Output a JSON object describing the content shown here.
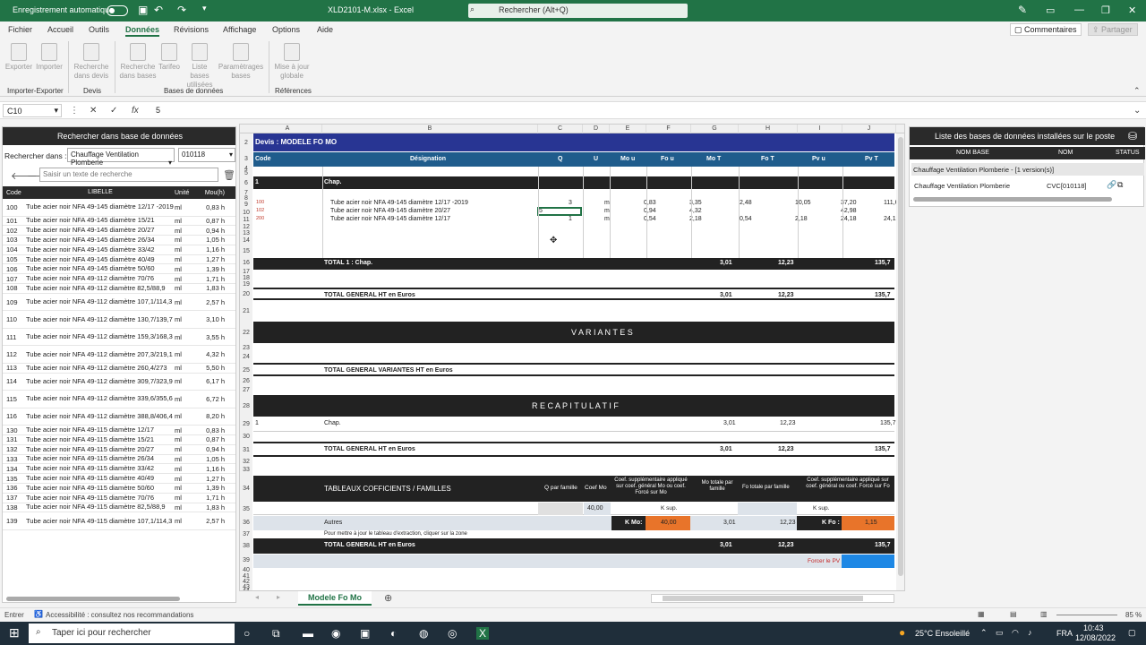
{
  "titlebar": {
    "autosave": "Enregistrement automatique",
    "filename": "XLD2101-M.xlsx  -  Excel",
    "search_placeholder": "Rechercher (Alt+Q)"
  },
  "menubar": {
    "items": [
      "Fichier",
      "Accueil",
      "Outils",
      "Données",
      "Révisions",
      "Affichage",
      "Options",
      "Aide"
    ],
    "active": "Données",
    "comments": "Commentaires",
    "share": "Partager"
  },
  "ribbon": {
    "buttons": [
      "Exporter",
      "Importer",
      "Recherche dans devis",
      "Recherche dans bases",
      "Tarifeo",
      "Liste bases utilisées",
      "Paramètrages bases",
      "Mise à jour globale"
    ],
    "groups": [
      "Importer-Exporter",
      "Devis",
      "Bases de données",
      "Références"
    ]
  },
  "formula": {
    "cell": "C10",
    "value": "5"
  },
  "leftpane": {
    "title": "Rechercher dans base de données",
    "search_in_label": "Rechercher dans :",
    "base_value": "Chauffage Ventilation Plomberie",
    "code_value": "010118",
    "search_placeholder": "Saisir un texte de recherche",
    "headers": [
      "Code",
      "LIBELLE",
      "Unité",
      "Mou(h)"
    ],
    "rows": [
      [
        "100",
        "Tube acier noir NFA 49-145 diamètre 12/17 -2019",
        "ml",
        "0,83 h"
      ],
      [
        "101",
        "Tube acier noir NFA 49-145 diamètre 15/21",
        "ml",
        "0,87 h"
      ],
      [
        "102",
        "Tube acier noir NFA 49-145 diamètre 20/27",
        "ml",
        "0,94 h"
      ],
      [
        "103",
        "Tube acier noir NFA 49-145 diamètre 26/34",
        "ml",
        "1,05 h"
      ],
      [
        "104",
        "Tube acier noir NFA 49-145 diamètre 33/42",
        "ml",
        "1,16 h"
      ],
      [
        "105",
        "Tube acier noir NFA 49-145 diamètre 40/49",
        "ml",
        "1,27 h"
      ],
      [
        "106",
        "Tube acier noir NFA 49-145 diamètre 50/60",
        "ml",
        "1,39 h"
      ],
      [
        "107",
        "Tube acier noir NFA 49-112 diamètre 70/76",
        "ml",
        "1,71 h"
      ],
      [
        "108",
        "Tube acier noir NFA 49-112 diamètre 82,5/88,9",
        "ml",
        "1,83 h"
      ],
      [
        "109",
        "Tube acier noir NFA 49-112 diamètre 107,1/114,3",
        "ml",
        "2,57 h"
      ],
      [
        "110",
        "Tube acier noir NFA 49-112 diamètre 130,7/139,7",
        "ml",
        "3,10 h"
      ],
      [
        "111",
        "Tube acier noir NFA 49-112 diamètre 159,3/168,3",
        "ml",
        "3,55 h"
      ],
      [
        "112",
        "Tube acier noir NFA 49-112 diamètre 207,3/219,1",
        "ml",
        "4,32 h"
      ],
      [
        "113",
        "Tube acier noir NFA 49-112 diamètre 260,4/273",
        "ml",
        "5,50 h"
      ],
      [
        "114",
        "Tube acier noir NFA 49-112 diamètre 309,7/323,9",
        "ml",
        "6,17 h"
      ],
      [
        "115",
        "Tube acier noir NFA 49-112 diamètre 339,6/355,6",
        "ml",
        "6,72 h"
      ],
      [
        "116",
        "Tube acier noir NFA 49-112 diamètre 388,8/406,4",
        "ml",
        "8,20 h"
      ],
      [
        "130",
        "Tube acier noir NFA 49-115 diamètre 12/17",
        "ml",
        "0,83 h"
      ],
      [
        "131",
        "Tube acier noir NFA 49-115 diamètre 15/21",
        "ml",
        "0,87 h"
      ],
      [
        "132",
        "Tube acier noir NFA 49-115 diamètre 20/27",
        "ml",
        "0,94 h"
      ],
      [
        "133",
        "Tube acier noir NFA 49-115 diamètre 26/34",
        "ml",
        "1,05 h"
      ],
      [
        "134",
        "Tube acier noir NFA 49-115 diamètre 33/42",
        "ml",
        "1,16 h"
      ],
      [
        "135",
        "Tube acier noir NFA 49-115 diamètre 40/49",
        "ml",
        "1,27 h"
      ],
      [
        "136",
        "Tube acier noir NFA 49-115 diamètre 50/60",
        "ml",
        "1,39 h"
      ],
      [
        "137",
        "Tube acier noir NFA 49-115 diamètre 70/76",
        "ml",
        "1,71 h"
      ],
      [
        "138",
        "Tube acier noir NFA 49-115 diamètre 82,5/88,9",
        "ml",
        "1,83 h"
      ],
      [
        "139",
        "Tube acier noir NFA 49-115 diamètre 107,1/114,3",
        "ml",
        "2,57 h"
      ]
    ]
  },
  "sheet": {
    "columns": [
      "A",
      "B",
      "C",
      "D",
      "E",
      "F",
      "G",
      "H",
      "I",
      "J"
    ],
    "devis_title": "Devis : MODELE FO MO",
    "headers": [
      "Code",
      "Désignation",
      "Q",
      "U",
      "Mo u",
      "Fo u",
      "Mo T",
      "Fo T",
      "Pv u",
      "Pv T"
    ],
    "chap_code": "1",
    "chap_label": "Chap.",
    "lines": [
      {
        "code": "100",
        "des": "Tube acier noir NFA 49-145 diamètre 12/17 -2019",
        "q": "3",
        "u": "ml",
        "mou": "0,83",
        "fou": "3,35",
        "mot": "2,48",
        "fot": "10,05",
        "pvu": "37,20",
        "pvt": "111,6"
      },
      {
        "code": "102",
        "des": "Tube acier noir NFA 49-145 diamètre 20/27",
        "q": "5",
        "u": "ml",
        "mou": "0,94",
        "fou": "4,32",
        "mot": "",
        "fot": "",
        "pvu": "42,98",
        "pvt": ""
      },
      {
        "code": "200",
        "des": "Tube acier noir NFA 49-145 diamètre 12/17",
        "q": "1",
        "u": "ml",
        "mou": "0,54",
        "fou": "2,18",
        "mot": "0,54",
        "fot": "2,18",
        "pvu": "24,18",
        "pvt": "24,1"
      }
    ],
    "total_chap": {
      "label": "TOTAL 1 : Chap.",
      "mot": "3,01",
      "fot": "12,23",
      "pvt": "135,7"
    },
    "total_general": {
      "label": "TOTAL GENERAL HT en Euros",
      "mot": "3,01",
      "fot": "12,23",
      "pvt": "135,7"
    },
    "variantes": "V A R I A N T E S",
    "total_variantes": "TOTAL GENERAL VARIANTES HT en Euros",
    "recap": "R E C A P I T U L A T I F",
    "recap_line": {
      "code": "1",
      "label": "Chap.",
      "mot": "3,01",
      "fot": "12,23",
      "pvt": "135,7"
    },
    "tableaux": {
      "title": "TABLEAUX COFFICIENTS / FAMILLES",
      "q_famille": "Q par famille",
      "coef_mo": "Coef Mo",
      "coef_supp_mo": "Coef. supplémentaire appliqué sur coef. général Mo ou coef. Forcé sur Mo",
      "mo_totale": "Mo totale par famille",
      "fo_totale": "Fo totale par famille",
      "coef_supp_fo": "Coef. supplémentaire appliqué sur coef. général ou coef. Forcé sur Fo",
      "coef_val": "40,00",
      "ksup": "K sup.",
      "autres": "Autres",
      "kmo_label": "K Mo:",
      "kmo_val": "40,00",
      "kfo_label": "K Fo :",
      "kfo_val": "1,15",
      "mot": "3,01",
      "fot": "12,23",
      "note": "Pour mettre à jour le tableau d'extraction, cliquer sur la zone",
      "forcer": "Forcer le PV"
    },
    "rows": [
      "2",
      "3",
      "4",
      "5",
      "6",
      "7",
      "8",
      "9",
      "10",
      "11",
      "12",
      "13",
      "14",
      "15",
      "16",
      "17",
      "18",
      "19",
      "20",
      "21",
      "22",
      "23",
      "24",
      "25",
      "26",
      "27",
      "28",
      "29",
      "30",
      "31",
      "32",
      "33",
      "34",
      "35",
      "36",
      "37",
      "38",
      "39",
      "40",
      "41",
      "42",
      "43",
      "44"
    ]
  },
  "rightpane": {
    "title": "Liste des bases de données installées sur le poste",
    "headers": [
      "NOM BASE",
      "NOM",
      "STATUS"
    ],
    "group": "Chauffage Ventilation Plomberie - [1 version(s)]",
    "row": {
      "base": "Chauffage Ventilation Plomberie",
      "nom": "CVC[010118]"
    }
  },
  "tabs": {
    "sheet": "Modele Fo Mo"
  },
  "status": {
    "mode": "Entrer",
    "accessibility": "Accessibilité : consultez nos recommandations",
    "zoom": "85 %"
  },
  "taskbar": {
    "search": "Taper ici pour rechercher",
    "weather": "25°C  Ensoleillé",
    "lang": "FRA",
    "time": "10:43",
    "date": "12/08/2022"
  }
}
